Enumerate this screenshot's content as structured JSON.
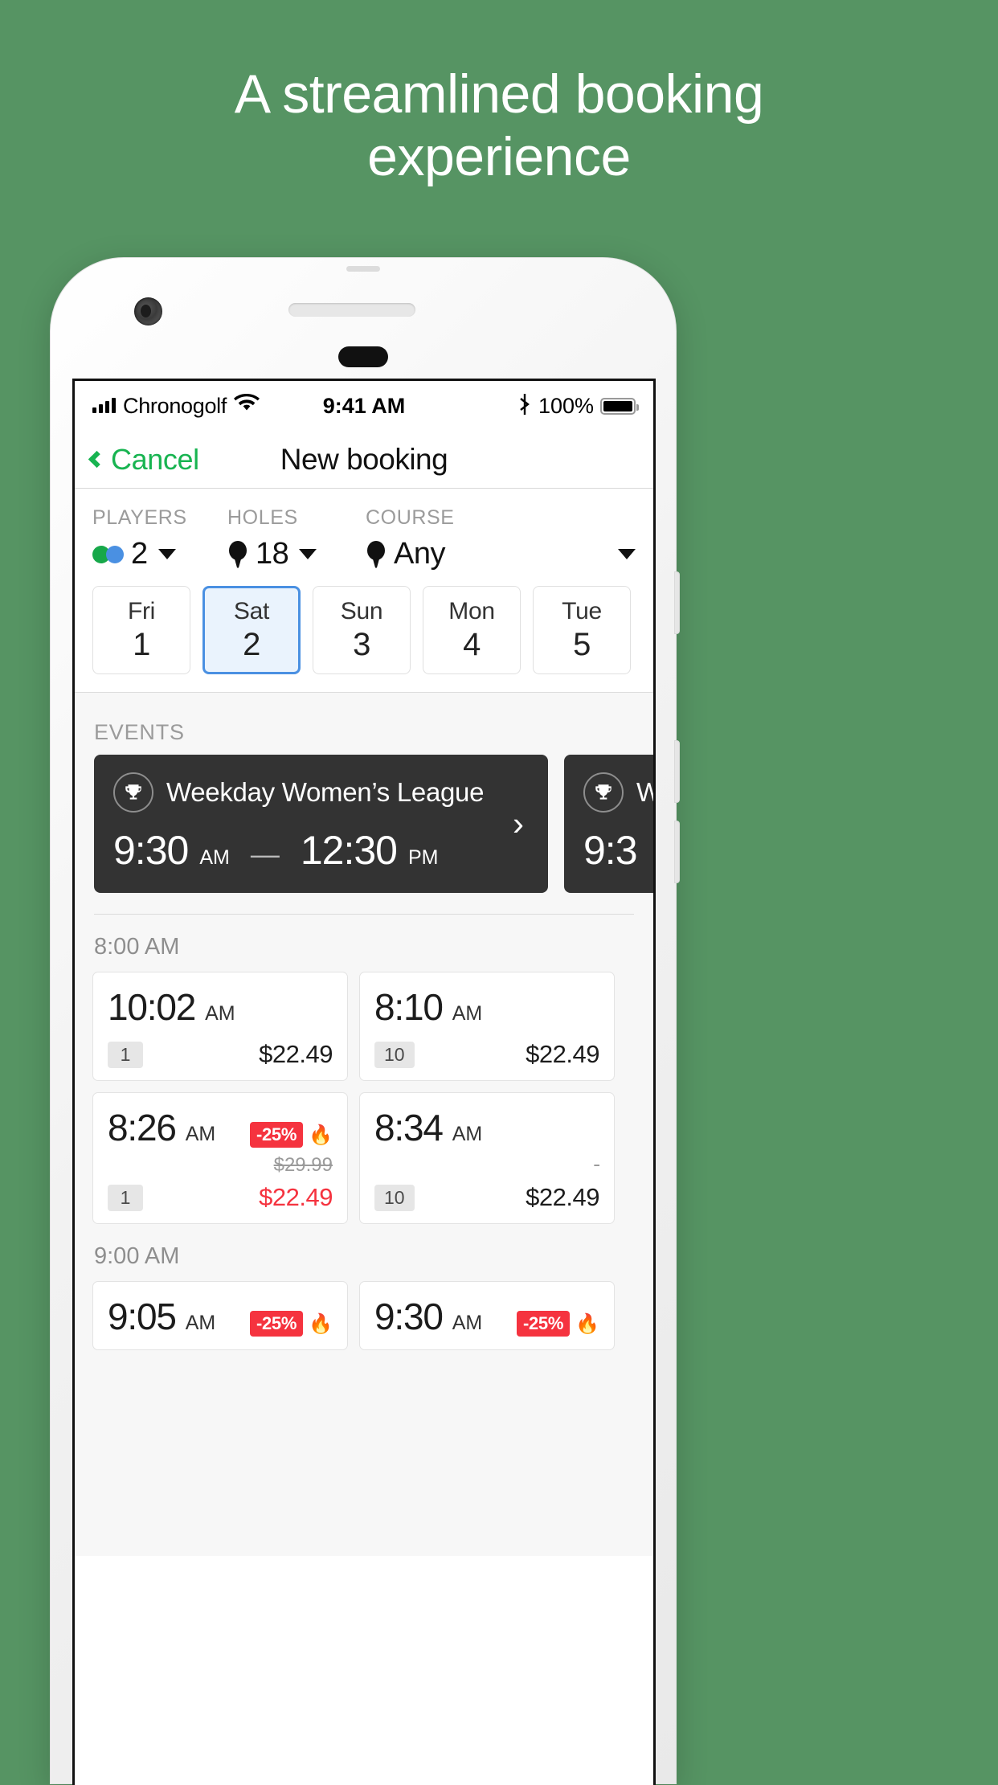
{
  "headline": {
    "line1": "A streamlined booking",
    "line2": "experience"
  },
  "colors": {
    "background": "#569463",
    "accent_green": "#18b451",
    "select_blue": "#4a90e2",
    "sale_red": "#f5333f",
    "event_dark": "#333333"
  },
  "status_bar": {
    "carrier": "Chronogolf",
    "time": "9:41 AM",
    "battery_percent": "100%",
    "signal_icon": "signal-bars-icon",
    "wifi_icon": "wifi-icon",
    "bluetooth_icon": "bluetooth-icon",
    "battery_icon": "battery-full-icon"
  },
  "nav": {
    "back_label": "Cancel",
    "title": "New booking",
    "back_icon": "chevron-left-icon"
  },
  "filters": [
    {
      "label": "PLAYERS",
      "value": "2",
      "icon": "players-dots-icon"
    },
    {
      "label": "HOLES",
      "value": "18",
      "icon": "golf-tee-icon"
    },
    {
      "label": "COURSE",
      "value": "Any",
      "icon": "golf-tee-icon"
    }
  ],
  "dates": [
    {
      "day": "Fri",
      "num": "1",
      "selected": false
    },
    {
      "day": "Sat",
      "num": "2",
      "selected": true
    },
    {
      "day": "Sun",
      "num": "3",
      "selected": false
    },
    {
      "day": "Mon",
      "num": "4",
      "selected": false
    },
    {
      "day": "Tue",
      "num": "5",
      "selected": false
    }
  ],
  "events_section": {
    "title": "EVENTS",
    "cards": [
      {
        "icon": "trophy-icon",
        "name": "Weekday Women’s League",
        "start_time": "9:30",
        "start_ampm": "AM",
        "dash": "—",
        "end_time": "12:30",
        "end_ampm": "PM",
        "arrow_icon": "chevron-right-icon"
      },
      {
        "icon": "trophy-icon",
        "name": "W",
        "start_time": "9:3",
        "start_ampm": "",
        "dash": "",
        "end_time": "",
        "end_ampm": "",
        "arrow_icon": "chevron-right-icon"
      }
    ]
  },
  "tee_time_groups": [
    {
      "header": "8:00 AM",
      "times": [
        {
          "time": "10:02",
          "ampm": "AM",
          "slots": "1",
          "price": "$22.49",
          "discount": null,
          "old_price": null,
          "on_sale": false
        },
        {
          "time": "8:10",
          "ampm": "AM",
          "slots": "10",
          "price": "$22.49",
          "discount": null,
          "old_price": null,
          "on_sale": false
        },
        {
          "time": "8:26",
          "ampm": "AM",
          "slots": "1",
          "price": "$22.49",
          "discount": "-25%",
          "old_price": "$29.99",
          "on_sale": true
        },
        {
          "time": "8:34",
          "ampm": "AM",
          "slots": "10",
          "price": "$22.49",
          "discount": null,
          "old_price": null,
          "on_sale": false
        }
      ]
    },
    {
      "header": "9:00 AM",
      "times": [
        {
          "time": "9:05",
          "ampm": "AM",
          "slots": "",
          "price": "",
          "discount": "-25%",
          "old_price": "",
          "on_sale": true
        },
        {
          "time": "9:30",
          "ampm": "AM",
          "slots": "",
          "price": "",
          "discount": "-25%",
          "old_price": "",
          "on_sale": true
        }
      ]
    }
  ],
  "icons": {
    "flame": "🔥",
    "trophy": "♛"
  }
}
